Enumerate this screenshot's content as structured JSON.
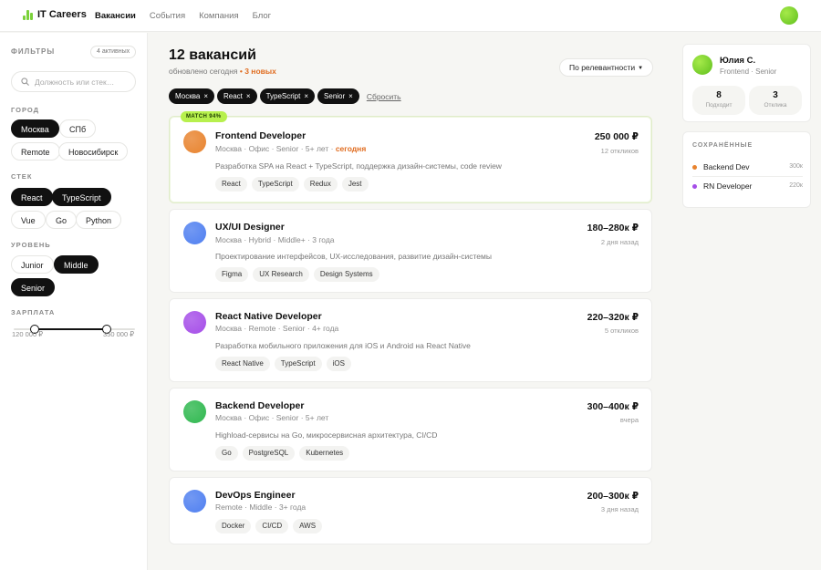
{
  "header": {
    "logo": "IT Careers",
    "nav": [
      "Вакансии",
      "События",
      "Компания",
      "Блог"
    ]
  },
  "sidebar": {
    "title": "ФИЛЬТРЫ",
    "active_badge": "4 активных",
    "search_placeholder": "Должность или стек…",
    "city_label": "ГОРОД",
    "cities": [
      {
        "label": "Москва",
        "on": true
      },
      {
        "label": "СПб",
        "on": false
      },
      {
        "label": "Remote",
        "on": false
      },
      {
        "label": "Новосибирск",
        "on": false
      }
    ],
    "stack_label": "СТЕК",
    "stack": [
      {
        "label": "React",
        "on": true
      },
      {
        "label": "TypeScript",
        "on": true
      },
      {
        "label": "Vue",
        "on": false
      },
      {
        "label": "Go",
        "on": false
      },
      {
        "label": "Python",
        "on": false
      }
    ],
    "level_label": "УРОВЕНЬ",
    "levels": [
      {
        "label": "Junior",
        "on": false
      },
      {
        "label": "Middle",
        "on": true
      },
      {
        "label": "Senior",
        "on": true
      }
    ],
    "salary_label": "ЗАРПЛАТА",
    "salary_min": "120 000 ₽",
    "salary_max": "350 000 ₽",
    "salary_range_fraction": [
      0.17,
      0.77
    ]
  },
  "main": {
    "title": "12 вакансий",
    "updated": "обновлено сегодня",
    "new_count": "3 новых",
    "sort_label": "По релевантности",
    "filters": [
      "Москва",
      "React",
      "TypeScript",
      "Senior"
    ],
    "reset": "Сбросить",
    "match_badge": "MATCH 94%",
    "jobs": [
      {
        "title": "Frontend Developer",
        "meta": [
          "Москва",
          "Офис",
          "Senior",
          "5+ лет"
        ],
        "meta_extra": "сегодня",
        "desc": "Разработка SPA на React + TypeScript, поддержка дизайн-системы, code review",
        "skills": [
          "React",
          "TypeScript",
          "Redux",
          "Jest"
        ],
        "salary": "250 000 ₽",
        "resp": "12 откликов",
        "color": "#e8832e"
      },
      {
        "title": "UX/UI Designer",
        "meta": [
          "Москва",
          "Hybrid",
          "Middle+",
          "3 года"
        ],
        "desc": "Проектирование интерфейсов, UX-исследования, развитие дизайн-системы",
        "skills": [
          "Figma",
          "UX Research",
          "Design Systems"
        ],
        "salary": "180–280к ₽",
        "resp": "2 дня назад",
        "color": "#4f7ff0"
      },
      {
        "title": "React Native Developer",
        "meta": [
          "Москва",
          "Remote",
          "Senior",
          "4+ года"
        ],
        "desc": "Разработка мобильного приложения для iOS и Android на React Native",
        "skills": [
          "React Native",
          "TypeScript",
          "iOS"
        ],
        "salary": "220–320к ₽",
        "resp": "5 откликов",
        "color": "#a54de8"
      },
      {
        "title": "Backend Developer",
        "meta": [
          "Москва",
          "Офис",
          "Senior",
          "5+ лет"
        ],
        "desc": "Highload-сервисы на Go, микросервисная архитектура, CI/CD",
        "skills": [
          "Go",
          "PostgreSQL",
          "Kubernetes"
        ],
        "salary": "300–400к ₽",
        "resp": "вчера",
        "color": "#2fb84f"
      },
      {
        "title": "DevOps Engineer",
        "meta": [
          "Remote",
          "Middle",
          "3+ года"
        ],
        "desc": "",
        "skills": [
          "Docker",
          "CI/CD",
          "AWS"
        ],
        "salary": "200–300к ₽",
        "resp": "3 дня назад",
        "color": "#4f7ff0"
      }
    ]
  },
  "profile": {
    "name": "Юлия С.",
    "role": "Frontend · Senior",
    "stats": [
      {
        "n": "8",
        "l": "Подходит"
      },
      {
        "n": "3",
        "l": "Отклика"
      }
    ]
  },
  "saved": {
    "title": "СОХРАНЁННЫЕ",
    "items": [
      {
        "name": "Backend Dev",
        "salary": "300к",
        "color": "#e8832e"
      },
      {
        "name": "RN Developer",
        "salary": "220к",
        "color": "#a54de8"
      }
    ]
  }
}
